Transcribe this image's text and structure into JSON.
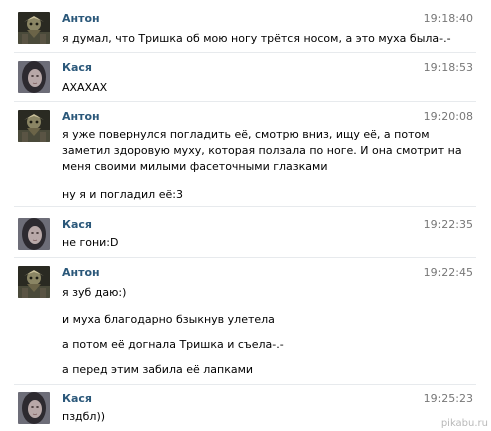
{
  "messages": [
    {
      "author": "Антон",
      "time": "19:18:40",
      "avatar": "anton",
      "lines": [
        "я думал, что Тришка об мою ногу трётся носом, а это муха была-.-"
      ]
    },
    {
      "author": "Кася",
      "time": "19:18:53",
      "avatar": "kasya",
      "lines": [
        "АХАХАХ"
      ]
    },
    {
      "author": "Антон",
      "time": "19:20:08",
      "avatar": "anton",
      "lines": [
        "я уже повернулся погладить её, смотрю вниз, ищу её, а потом",
        "заметил здоровую муху, которая ползала по ноге. И она смотрит на",
        "меня своими милыми фасеточными глазками",
        "ну я и погладил её:3"
      ]
    },
    {
      "author": "Кася",
      "time": "19:22:35",
      "avatar": "kasya",
      "lines": [
        "не гони:D"
      ]
    },
    {
      "author": "Антон",
      "time": "19:22:45",
      "avatar": "anton",
      "lines": [
        "я зуб даю:)",
        "и муха благодарно бзыкнув улетела",
        "а потом её догнала Тришка и съела-.-",
        "а перед этим забила её лапками"
      ]
    },
    {
      "author": "Кася",
      "time": "19:25:23",
      "avatar": "kasya",
      "lines": [
        "пздбл))"
      ]
    }
  ],
  "watermark": "pikabu.ru",
  "colors": {
    "author": "#2b587a",
    "time": "#777777",
    "divider": "#e7eaed"
  }
}
